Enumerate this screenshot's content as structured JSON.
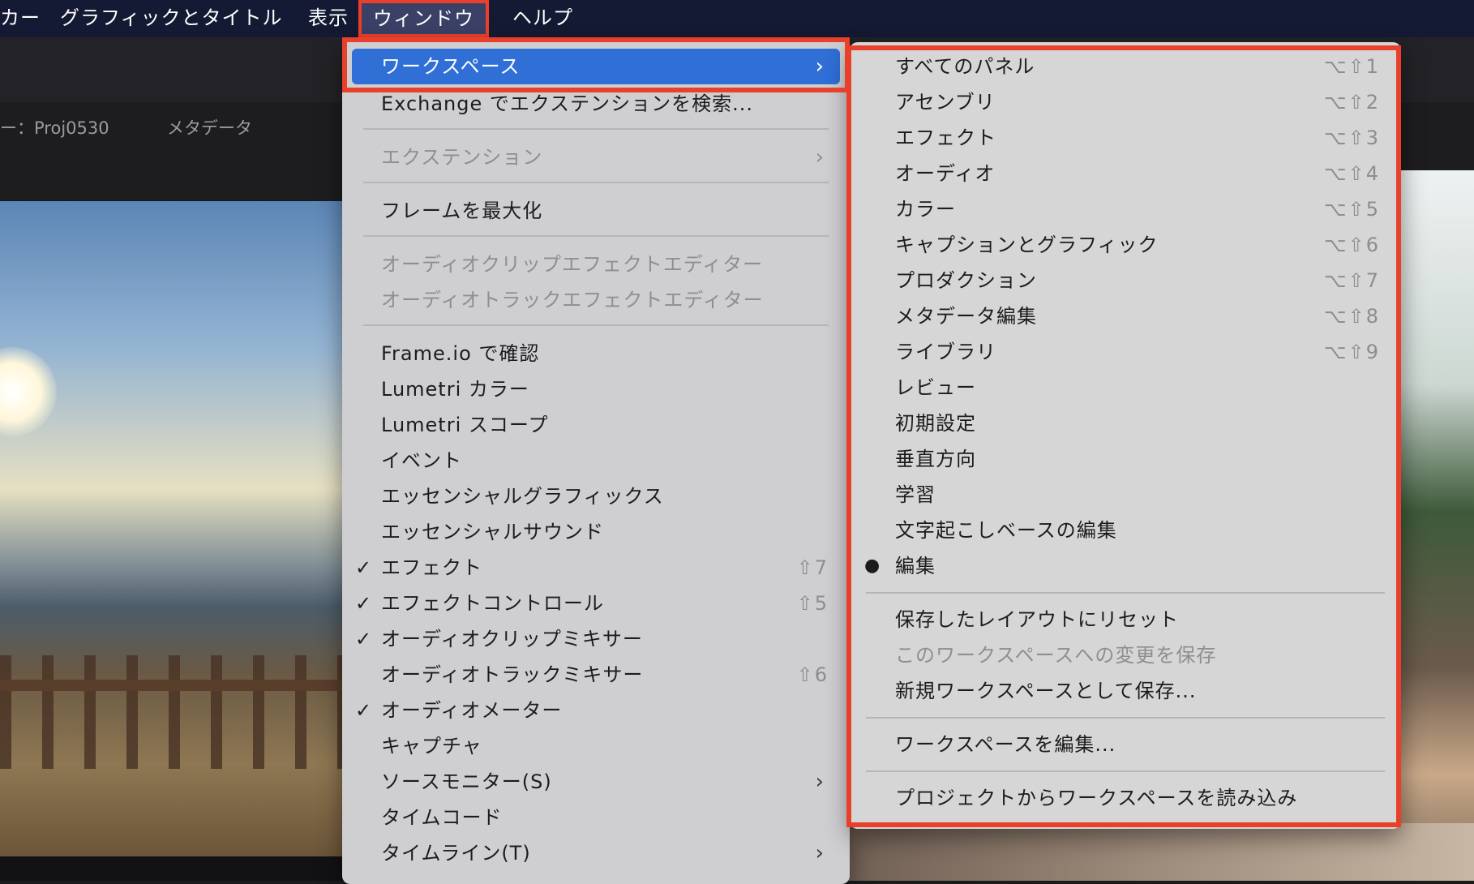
{
  "menubar": {
    "items": [
      {
        "label": "カー",
        "active": false
      },
      {
        "label": "グラフィックとタイトル",
        "active": false
      },
      {
        "label": "表示",
        "active": false
      },
      {
        "label": "ウィンドウ",
        "active": true
      },
      {
        "label": "ヘルプ",
        "active": false
      }
    ]
  },
  "background": {
    "project_tab": "ー：Proj0530",
    "metadata_tab": "メタデータ"
  },
  "window_menu": {
    "items": [
      {
        "label": "ワークスペース",
        "submenu": true,
        "highlight": true
      },
      {
        "label": "Exchange でエクステンションを検索..."
      },
      {
        "label": "エクステンション",
        "submenu": true,
        "disabled": true
      },
      {
        "label": "フレームを最大化"
      },
      {
        "label": "オーディオクリップエフェクトエディター",
        "disabled": true
      },
      {
        "label": "オーディオトラックエフェクトエディター",
        "disabled": true
      },
      {
        "label": "Frame.io で確認"
      },
      {
        "label": "Lumetri カラー"
      },
      {
        "label": "Lumetri スコープ"
      },
      {
        "label": "イベント"
      },
      {
        "label": "エッセンシャルグラフィックス"
      },
      {
        "label": "エッセンシャルサウンド"
      },
      {
        "label": "エフェクト",
        "checked": true,
        "shortcut": "⇧7"
      },
      {
        "label": "エフェクトコントロール",
        "checked": true,
        "shortcut": "⇧5"
      },
      {
        "label": "オーディオクリップミキサー",
        "checked": true
      },
      {
        "label": "オーディオトラックミキサー",
        "shortcut": "⇧6"
      },
      {
        "label": "オーディオメーター",
        "checked": true
      },
      {
        "label": "キャプチャ"
      },
      {
        "label": "ソースモニター(S)",
        "submenu": true
      },
      {
        "label": "タイムコード"
      },
      {
        "label": "タイムライン(T)",
        "submenu": true
      }
    ]
  },
  "workspace_menu": {
    "items": [
      {
        "label": "すべてのパネル",
        "shortcut": "⌥⇧1"
      },
      {
        "label": "アセンブリ",
        "shortcut": "⌥⇧2"
      },
      {
        "label": "エフェクト",
        "shortcut": "⌥⇧3"
      },
      {
        "label": "オーディオ",
        "shortcut": "⌥⇧4"
      },
      {
        "label": "カラー",
        "shortcut": "⌥⇧5"
      },
      {
        "label": "キャプションとグラフィック",
        "shortcut": "⌥⇧6"
      },
      {
        "label": "プロダクション",
        "shortcut": "⌥⇧7"
      },
      {
        "label": "メタデータ編集",
        "shortcut": "⌥⇧8"
      },
      {
        "label": "ライブラリ",
        "shortcut": "⌥⇧9"
      },
      {
        "label": "レビュー"
      },
      {
        "label": "初期設定"
      },
      {
        "label": "垂直方向"
      },
      {
        "label": "学習"
      },
      {
        "label": "文字起こしベースの編集"
      },
      {
        "label": "編集",
        "selected": true
      },
      {
        "label": "保存したレイアウトにリセット"
      },
      {
        "label": "このワークスペースへの変更を保存",
        "disabled": true
      },
      {
        "label": "新規ワークスペースとして保存..."
      },
      {
        "label": "ワークスペースを編集..."
      },
      {
        "label": "プロジェクトからワークスペースを読み込み"
      }
    ]
  },
  "colors": {
    "menubar_bg": "#141a33",
    "highlight": "#2f6fd6",
    "annotation_red": "#e8402b"
  }
}
